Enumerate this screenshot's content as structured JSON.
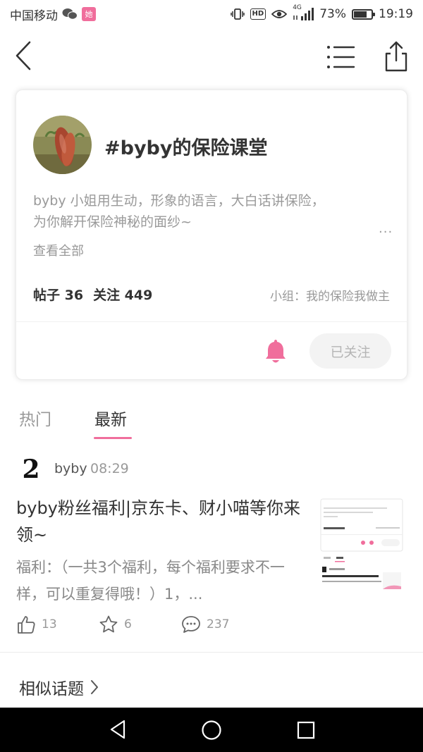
{
  "status_bar": {
    "carrier": "中国移动",
    "app_badge": "她",
    "network": "4G",
    "hd": "HD",
    "battery_percent": "73%",
    "battery_level": 0.73,
    "time": "19:19"
  },
  "header": {
    "back_icon": "chevron-left-icon",
    "list_icon": "list-icon",
    "share_icon": "share-icon"
  },
  "topic": {
    "title": "#byby的保险课堂",
    "description_line1": "byby 小姐用生动，形象的语言，大白话讲保险，",
    "description_line2": "为你解开保险神秘的面纱~",
    "more": "...",
    "view_all": "查看全部",
    "posts_label": "帖子 36",
    "follow_label": "关注 449",
    "group_prefix": "小组：",
    "group_name": "我的保险我做主",
    "followed_button": "已关注",
    "accent_color": "#f06e9c"
  },
  "tabs": {
    "hot": "热门",
    "new": "最新",
    "active": "最新"
  },
  "post": {
    "author": "byby",
    "time": "08:29",
    "title": "byby粉丝福利|京东卡、财小喵等你来领~",
    "excerpt": "福利：（一共3个福利，每个福利要求不一样，可以重复得哦！）1，...",
    "likes": "13",
    "favorites": "6",
    "comments": "237"
  },
  "similar_topics": {
    "label": "相似话题"
  }
}
